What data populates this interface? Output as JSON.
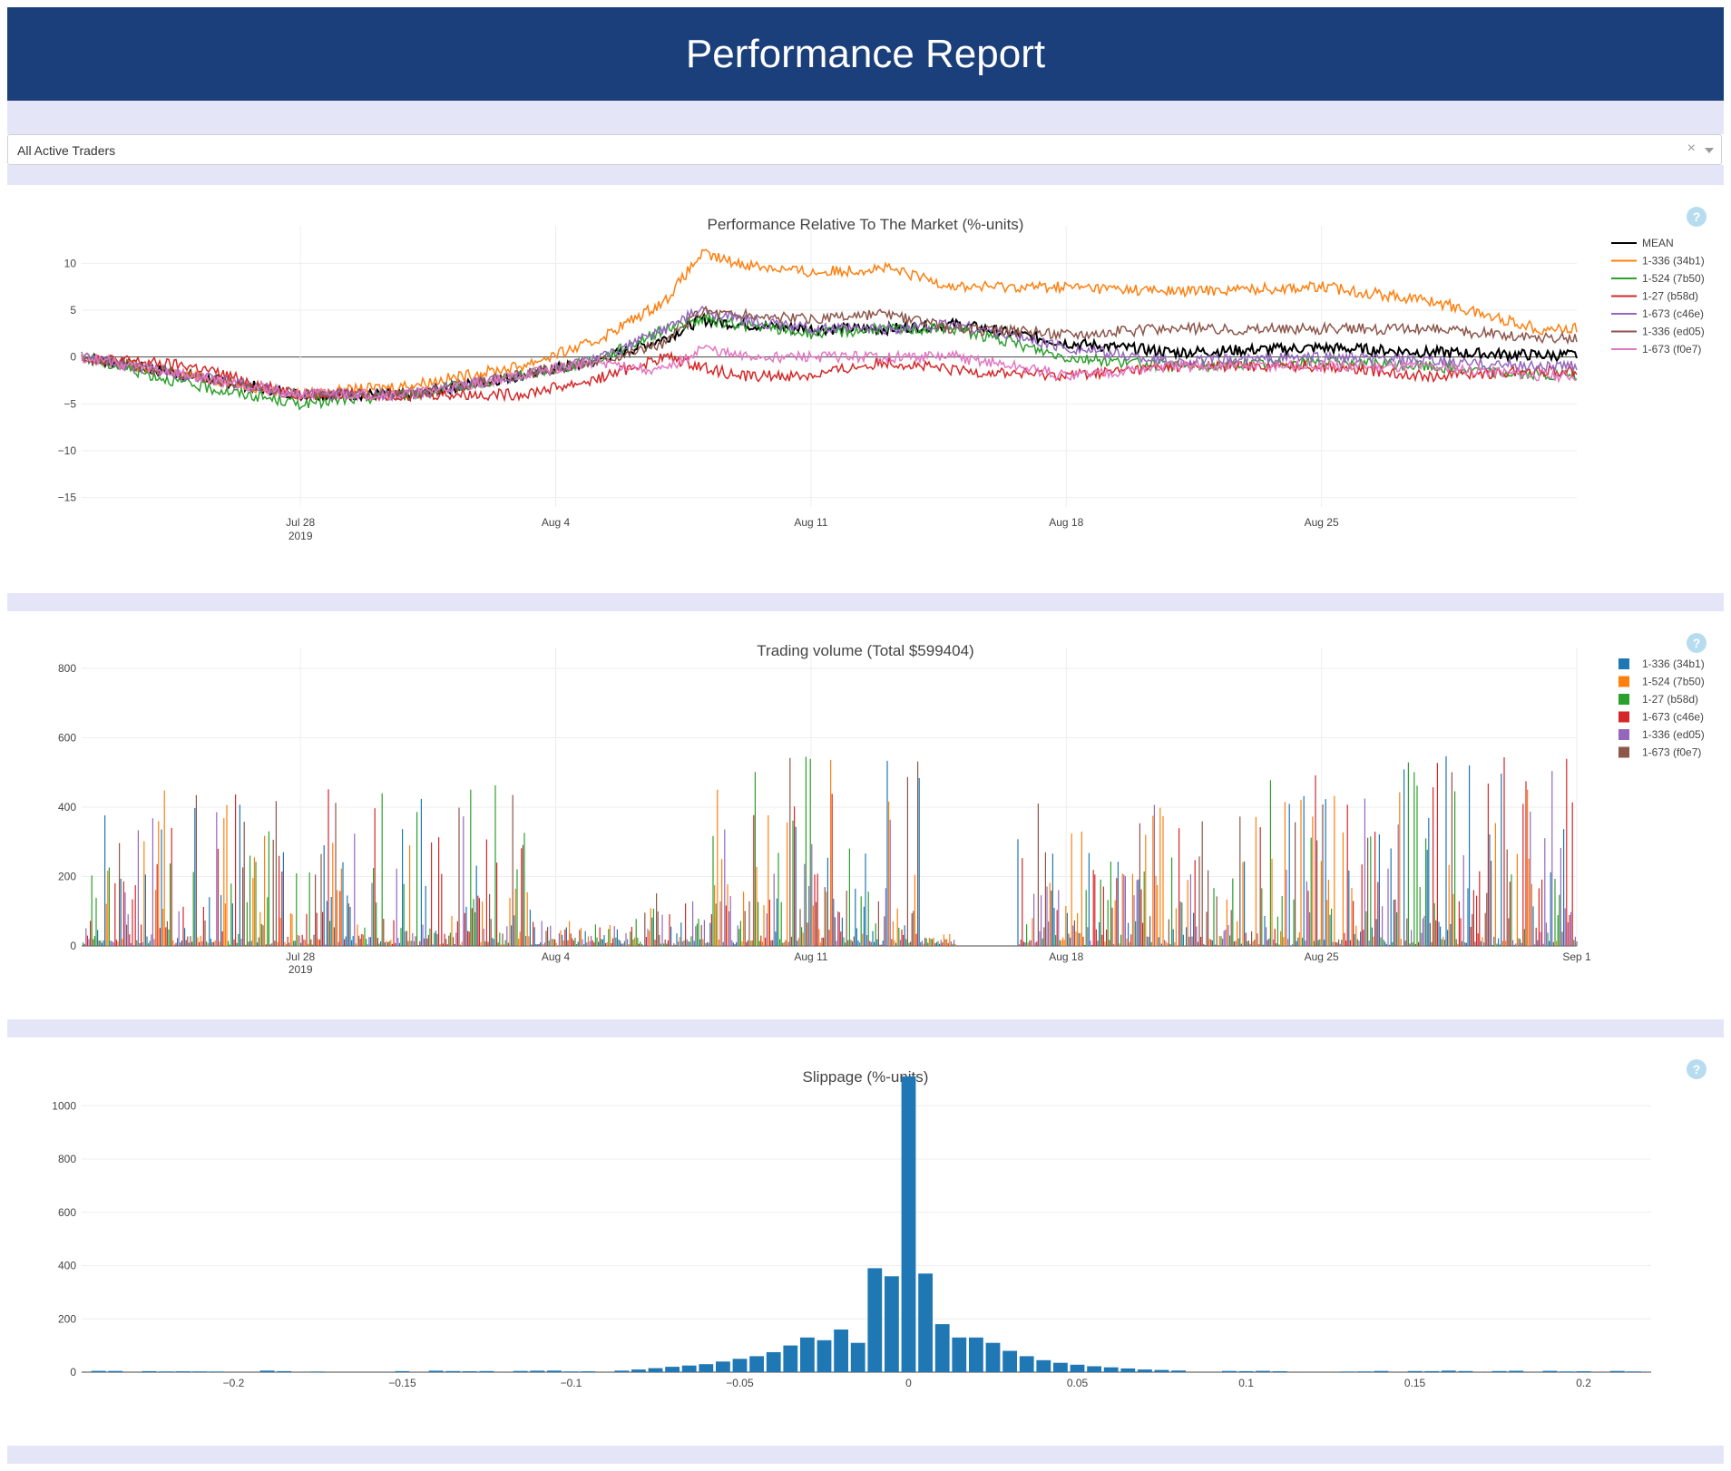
{
  "header": {
    "title": "Performance Report"
  },
  "filter": {
    "value": "All Active Traders",
    "clear_glyph": "×"
  },
  "help_glyph": "?",
  "colors": {
    "header_bg": "#1b3f7a",
    "band": "#e4e6f8",
    "series": [
      "#000000",
      "#ff7f0e",
      "#2ca02c",
      "#d62728",
      "#9467bd",
      "#8c564b",
      "#e377c2"
    ],
    "bars": [
      "#1f77b4",
      "#ff7f0e",
      "#2ca02c",
      "#d62728",
      "#9467bd",
      "#8c564b"
    ]
  },
  "chart_data": [
    {
      "type": "line",
      "title": "Performance Relative To The Market (%-units)",
      "x_ticks": [
        "Jul 28",
        "Aug 4",
        "Aug 11",
        "Aug 18",
        "Aug 25"
      ],
      "x_year": "2019",
      "xlim": [
        "2019-07-22",
        "2019-09-01"
      ],
      "ylim": [
        -16,
        14
      ],
      "y_ticks": [
        -15,
        -10,
        -5,
        0,
        5,
        10
      ],
      "x": [
        "Jul 22",
        "Jul 25",
        "Jul 28",
        "Jul 31",
        "Aug 3",
        "Aug 5",
        "Aug 7",
        "Aug 8",
        "Aug 9",
        "Aug 11",
        "Aug 13",
        "Aug 15",
        "Aug 18",
        "Aug 21",
        "Aug 25",
        "Aug 28",
        "Aug 31"
      ],
      "series": [
        {
          "name": "MEAN",
          "values": [
            0,
            -2,
            -4,
            -4,
            -2,
            -0.5,
            2,
            4,
            3.5,
            3,
            3,
            3.5,
            1.5,
            0.5,
            1,
            0.5,
            0.2
          ]
        },
        {
          "name": "1-336 (34b1)",
          "values": [
            0,
            -2,
            -4,
            -3,
            -1,
            1.5,
            6,
            11,
            10,
            9,
            9.5,
            7.5,
            7.5,
            7,
            7.5,
            6,
            3
          ]
        },
        {
          "name": "1-524 (7b50)",
          "values": [
            0,
            -3,
            -5,
            -4,
            -2,
            -0.5,
            3,
            4,
            3.5,
            2.5,
            3,
            3,
            0,
            -1,
            -0.5,
            -1,
            -2
          ]
        },
        {
          "name": "1-27 (b58d)",
          "values": [
            0,
            -1,
            -4,
            -4,
            -4,
            -2.5,
            0,
            -1,
            -2,
            -2,
            -0.5,
            -1.5,
            -2,
            -1,
            -1,
            -2,
            -1.5
          ]
        },
        {
          "name": "1-673 (c46e)",
          "values": [
            0,
            -2,
            -4,
            -4,
            -2,
            -0.5,
            3,
            5,
            4,
            3,
            3,
            3.5,
            1,
            -0.5,
            0,
            -0.5,
            -1
          ]
        },
        {
          "name": "1-336 (ed05)",
          "values": [
            0,
            -2,
            -4,
            -4,
            -2,
            -0.5,
            1.5,
            5,
            4.5,
            4,
            4.5,
            3,
            2.5,
            3,
            3,
            3,
            2
          ]
        },
        {
          "name": "1-673 (f0e7)",
          "values": [
            0,
            -2,
            -4,
            -4,
            -2,
            -0.5,
            -1.5,
            1,
            0,
            0,
            0,
            0,
            -2,
            -1,
            -1,
            -1,
            -2
          ]
        }
      ]
    },
    {
      "type": "bar",
      "title": "Trading volume (Total $599404)",
      "x_ticks": [
        "Jul 28",
        "Aug 4",
        "Aug 11",
        "Aug 18",
        "Aug 25",
        "Sep 1"
      ],
      "x_year": "2019",
      "xlim": [
        "2019-07-22",
        "2019-09-01"
      ],
      "ylim": [
        0,
        860
      ],
      "y_ticks": [
        0,
        200,
        400,
        600,
        800
      ],
      "legend": [
        "1-336 (34b1)",
        "1-524 (7b50)",
        "1-27 (b58d)",
        "1-673 (c46e)",
        "1-336 (ed05)",
        "1-673 (f0e7)"
      ]
    },
    {
      "type": "bar",
      "title": "Slippage (%-units)",
      "x_ticks": [
        -0.2,
        -0.15,
        -0.1,
        -0.05,
        0,
        0.05,
        0.1,
        0.15,
        0.2
      ],
      "y_ticks": [
        0,
        200,
        400,
        600,
        800,
        1000
      ],
      "xlim": [
        -0.245,
        0.22
      ],
      "ylim": [
        0,
        1120
      ],
      "bins": [
        -0.08,
        -0.075,
        -0.07,
        -0.065,
        -0.06,
        -0.055,
        -0.05,
        -0.045,
        -0.04,
        -0.035,
        -0.03,
        -0.025,
        -0.02,
        -0.015,
        -0.01,
        -0.005,
        0,
        0.005,
        0.01,
        0.015,
        0.02,
        0.025,
        0.03,
        0.035,
        0.04,
        0.045,
        0.05,
        0.055,
        0.06,
        0.065,
        0.07,
        0.075,
        0.08
      ],
      "values": [
        10,
        15,
        20,
        25,
        30,
        40,
        50,
        60,
        75,
        100,
        130,
        120,
        160,
        110,
        390,
        360,
        1110,
        370,
        180,
        130,
        130,
        110,
        80,
        60,
        45,
        35,
        28,
        22,
        18,
        14,
        10,
        8,
        6
      ]
    }
  ]
}
